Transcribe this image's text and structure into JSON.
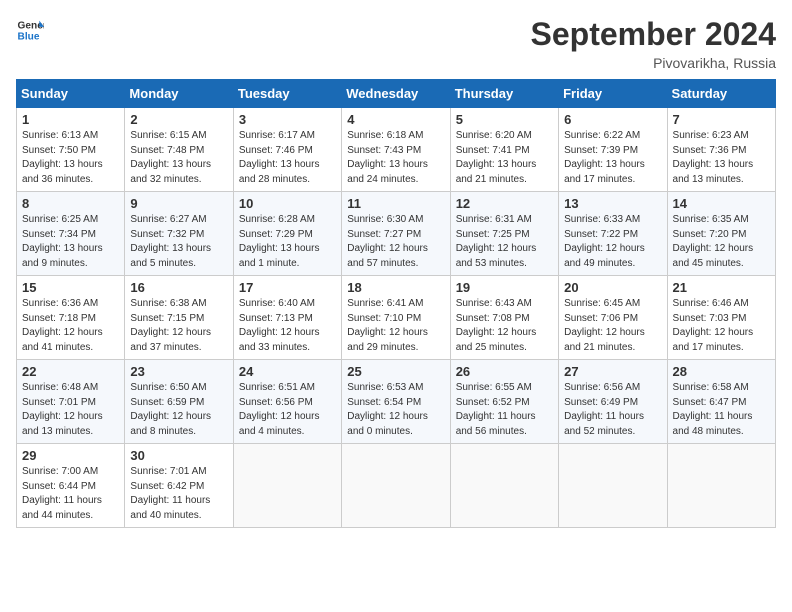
{
  "header": {
    "logo_line1": "General",
    "logo_line2": "Blue",
    "month": "September 2024",
    "location": "Pivovarikha, Russia"
  },
  "weekdays": [
    "Sunday",
    "Monday",
    "Tuesday",
    "Wednesday",
    "Thursday",
    "Friday",
    "Saturday"
  ],
  "weeks": [
    [
      {
        "day": "1",
        "info": "Sunrise: 6:13 AM\nSunset: 7:50 PM\nDaylight: 13 hours\nand 36 minutes."
      },
      {
        "day": "2",
        "info": "Sunrise: 6:15 AM\nSunset: 7:48 PM\nDaylight: 13 hours\nand 32 minutes."
      },
      {
        "day": "3",
        "info": "Sunrise: 6:17 AM\nSunset: 7:46 PM\nDaylight: 13 hours\nand 28 minutes."
      },
      {
        "day": "4",
        "info": "Sunrise: 6:18 AM\nSunset: 7:43 PM\nDaylight: 13 hours\nand 24 minutes."
      },
      {
        "day": "5",
        "info": "Sunrise: 6:20 AM\nSunset: 7:41 PM\nDaylight: 13 hours\nand 21 minutes."
      },
      {
        "day": "6",
        "info": "Sunrise: 6:22 AM\nSunset: 7:39 PM\nDaylight: 13 hours\nand 17 minutes."
      },
      {
        "day": "7",
        "info": "Sunrise: 6:23 AM\nSunset: 7:36 PM\nDaylight: 13 hours\nand 13 minutes."
      }
    ],
    [
      {
        "day": "8",
        "info": "Sunrise: 6:25 AM\nSunset: 7:34 PM\nDaylight: 13 hours\nand 9 minutes."
      },
      {
        "day": "9",
        "info": "Sunrise: 6:27 AM\nSunset: 7:32 PM\nDaylight: 13 hours\nand 5 minutes."
      },
      {
        "day": "10",
        "info": "Sunrise: 6:28 AM\nSunset: 7:29 PM\nDaylight: 13 hours\nand 1 minute."
      },
      {
        "day": "11",
        "info": "Sunrise: 6:30 AM\nSunset: 7:27 PM\nDaylight: 12 hours\nand 57 minutes."
      },
      {
        "day": "12",
        "info": "Sunrise: 6:31 AM\nSunset: 7:25 PM\nDaylight: 12 hours\nand 53 minutes."
      },
      {
        "day": "13",
        "info": "Sunrise: 6:33 AM\nSunset: 7:22 PM\nDaylight: 12 hours\nand 49 minutes."
      },
      {
        "day": "14",
        "info": "Sunrise: 6:35 AM\nSunset: 7:20 PM\nDaylight: 12 hours\nand 45 minutes."
      }
    ],
    [
      {
        "day": "15",
        "info": "Sunrise: 6:36 AM\nSunset: 7:18 PM\nDaylight: 12 hours\nand 41 minutes."
      },
      {
        "day": "16",
        "info": "Sunrise: 6:38 AM\nSunset: 7:15 PM\nDaylight: 12 hours\nand 37 minutes."
      },
      {
        "day": "17",
        "info": "Sunrise: 6:40 AM\nSunset: 7:13 PM\nDaylight: 12 hours\nand 33 minutes."
      },
      {
        "day": "18",
        "info": "Sunrise: 6:41 AM\nSunset: 7:10 PM\nDaylight: 12 hours\nand 29 minutes."
      },
      {
        "day": "19",
        "info": "Sunrise: 6:43 AM\nSunset: 7:08 PM\nDaylight: 12 hours\nand 25 minutes."
      },
      {
        "day": "20",
        "info": "Sunrise: 6:45 AM\nSunset: 7:06 PM\nDaylight: 12 hours\nand 21 minutes."
      },
      {
        "day": "21",
        "info": "Sunrise: 6:46 AM\nSunset: 7:03 PM\nDaylight: 12 hours\nand 17 minutes."
      }
    ],
    [
      {
        "day": "22",
        "info": "Sunrise: 6:48 AM\nSunset: 7:01 PM\nDaylight: 12 hours\nand 13 minutes."
      },
      {
        "day": "23",
        "info": "Sunrise: 6:50 AM\nSunset: 6:59 PM\nDaylight: 12 hours\nand 8 minutes."
      },
      {
        "day": "24",
        "info": "Sunrise: 6:51 AM\nSunset: 6:56 PM\nDaylight: 12 hours\nand 4 minutes."
      },
      {
        "day": "25",
        "info": "Sunrise: 6:53 AM\nSunset: 6:54 PM\nDaylight: 12 hours\nand 0 minutes."
      },
      {
        "day": "26",
        "info": "Sunrise: 6:55 AM\nSunset: 6:52 PM\nDaylight: 11 hours\nand 56 minutes."
      },
      {
        "day": "27",
        "info": "Sunrise: 6:56 AM\nSunset: 6:49 PM\nDaylight: 11 hours\nand 52 minutes."
      },
      {
        "day": "28",
        "info": "Sunrise: 6:58 AM\nSunset: 6:47 PM\nDaylight: 11 hours\nand 48 minutes."
      }
    ],
    [
      {
        "day": "29",
        "info": "Sunrise: 7:00 AM\nSunset: 6:44 PM\nDaylight: 11 hours\nand 44 minutes."
      },
      {
        "day": "30",
        "info": "Sunrise: 7:01 AM\nSunset: 6:42 PM\nDaylight: 11 hours\nand 40 minutes."
      },
      {
        "day": "",
        "info": ""
      },
      {
        "day": "",
        "info": ""
      },
      {
        "day": "",
        "info": ""
      },
      {
        "day": "",
        "info": ""
      },
      {
        "day": "",
        "info": ""
      }
    ]
  ]
}
